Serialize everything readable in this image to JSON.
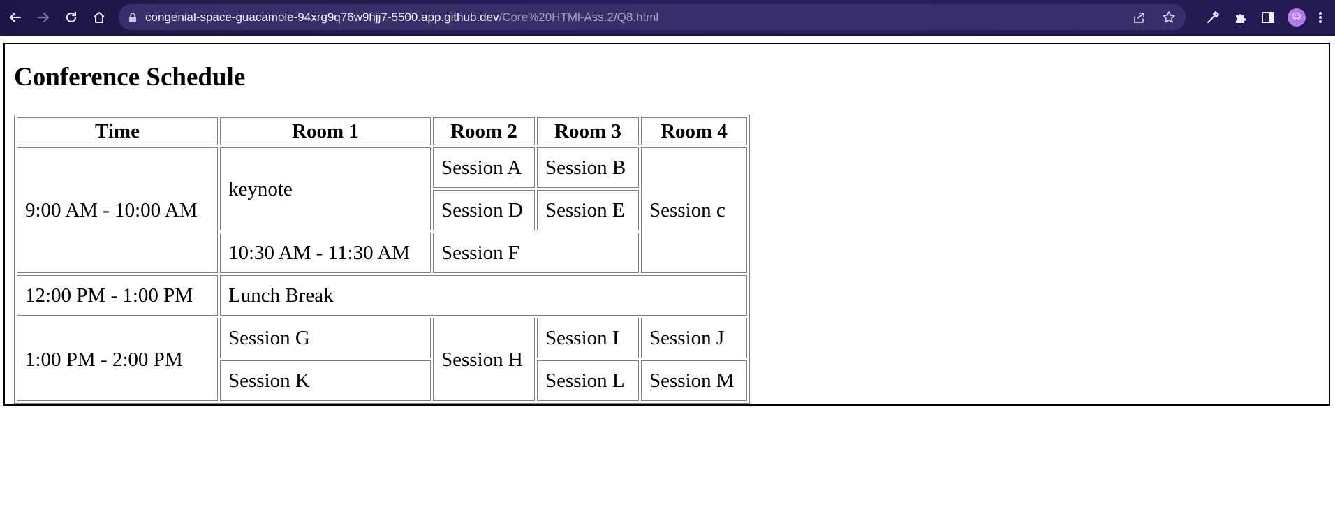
{
  "browser": {
    "url_host": "congenial-space-guacamole-94xrg9q76w9hjj7-5500.app.github.dev",
    "url_path": "/Core%20HTMl-Ass.2/Q8.html"
  },
  "page": {
    "title": "Conference Schedule"
  },
  "table": {
    "headers": [
      "Time",
      "Room 1",
      "Room 2",
      "Room 3",
      "Room 4"
    ],
    "cells": {
      "time_1": "9:00 AM - 10:00 AM",
      "keynote": "keynote",
      "session_a": "Session A",
      "session_b": "Session B",
      "session_c": "Session c",
      "session_d": "Session D",
      "session_e": "Session E",
      "time_2": "10:30 AM - 11:30 AM",
      "session_f": "Session F",
      "time_3": "12:00 PM - 1:00 PM",
      "lunch": "Lunch Break",
      "time_4": "1:00 PM - 2:00 PM",
      "session_g": "Session G",
      "session_h": "Session H",
      "session_i": "Session I",
      "session_j": "Session J",
      "session_k": "Session K",
      "session_l": "Session L",
      "session_m": "Session M"
    }
  }
}
